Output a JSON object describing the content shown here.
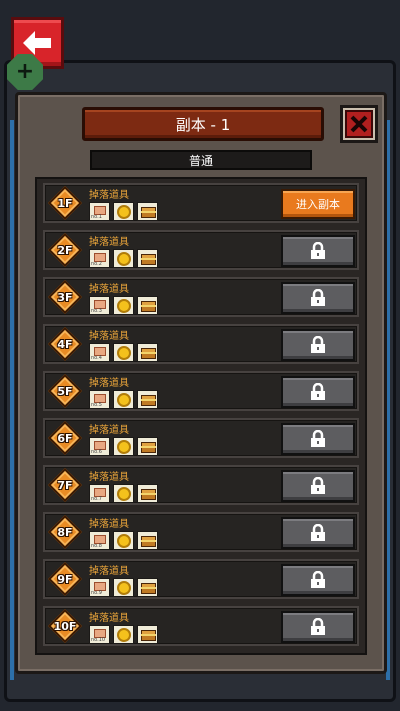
{
  "modal": {
    "title": "副本 - 1",
    "mode": "普通"
  },
  "drop_label": "掉落道具",
  "enter_label": "进入副本",
  "icons": {
    "back": "back-arrow-icon",
    "close": "close-x-icon",
    "lock": "lock-icon",
    "scroll": "scroll-item-icon",
    "coin": "gold-coin-icon",
    "chest": "treasure-chest-icon"
  },
  "colors": {
    "accent_orange": "#e97a1e",
    "drop_label": "#e9a43a",
    "back_red": "#d8242a"
  },
  "floors": [
    {
      "label": "1F",
      "scroll_label": "no.1",
      "unlocked": true
    },
    {
      "label": "2F",
      "scroll_label": "no.2",
      "unlocked": false
    },
    {
      "label": "3F",
      "scroll_label": "no.3",
      "unlocked": false
    },
    {
      "label": "4F",
      "scroll_label": "no.4",
      "unlocked": false
    },
    {
      "label": "5F",
      "scroll_label": "no.5",
      "unlocked": false
    },
    {
      "label": "6F",
      "scroll_label": "no.6",
      "unlocked": false
    },
    {
      "label": "7F",
      "scroll_label": "no.7",
      "unlocked": false
    },
    {
      "label": "8F",
      "scroll_label": "no.8",
      "unlocked": false
    },
    {
      "label": "9F",
      "scroll_label": "no.9",
      "unlocked": false
    },
    {
      "label": "10F",
      "scroll_label": "no.10",
      "unlocked": false
    }
  ]
}
